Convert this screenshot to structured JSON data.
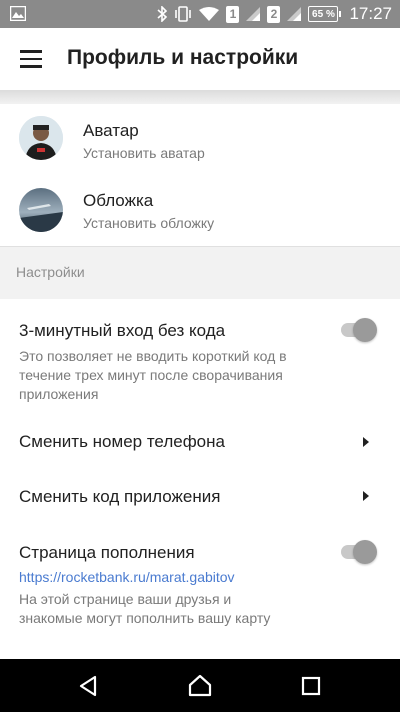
{
  "status_bar": {
    "sim1": "1",
    "sim2": "2",
    "battery": "65 %",
    "time": "17:27",
    "icons": [
      "image-icon",
      "bluetooth-icon",
      "vibrate-icon",
      "wifi-icon",
      "signal-icon",
      "signal-icon"
    ]
  },
  "appbar": {
    "title": "Профиль и настройки",
    "menu_icon": "hamburger-menu-icon"
  },
  "profile": {
    "avatar": {
      "title": "Аватар",
      "subtitle": "Установить аватар"
    },
    "cover": {
      "title": "Обложка",
      "subtitle": "Установить обложку"
    }
  },
  "settings": {
    "header": "Настройки",
    "quick_login": {
      "title": "3-минутный вход без кода",
      "description": "Это позволяет не вводить короткий код в течение трех минут после сворачивания приложения",
      "enabled": false
    },
    "change_phone": {
      "title": "Сменить номер телефона"
    },
    "change_code": {
      "title": "Сменить код приложения"
    },
    "topup_page": {
      "title": "Страница пополнения",
      "link": "https://rocketbank.ru/marat.gabitov",
      "description": "На этой странице ваши друзья и знакомые могут пополнить вашу карту",
      "enabled": false
    }
  },
  "nav_bar": {
    "buttons": [
      "back-icon",
      "home-icon",
      "recents-icon"
    ]
  },
  "colors": {
    "status_bar": "#8a8a8a",
    "link": "#4a7bd0",
    "section_bg": "#f2f2f2",
    "nav_bar": "#000000"
  }
}
